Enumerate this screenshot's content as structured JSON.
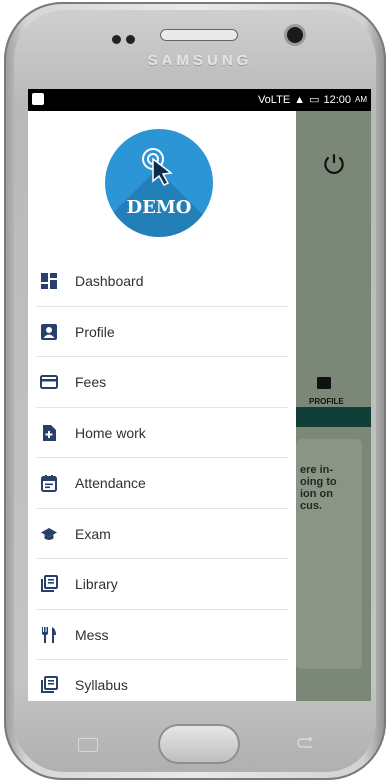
{
  "device": {
    "brand": "SAMSUNG"
  },
  "status_bar": {
    "time": "12:00",
    "ampm": "AM",
    "network": "VoLTE"
  },
  "logo": {
    "text": "DEMO"
  },
  "menu": {
    "items": [
      {
        "label": "Dashboard",
        "icon": "dashboard-icon"
      },
      {
        "label": "Profile",
        "icon": "profile-icon"
      },
      {
        "label": "Fees",
        "icon": "credit-card-icon"
      },
      {
        "label": "Home work",
        "icon": "homework-icon"
      },
      {
        "label": "Attendance",
        "icon": "calendar-icon"
      },
      {
        "label": "Exam",
        "icon": "graduation-cap-icon"
      },
      {
        "label": "Library",
        "icon": "library-icon"
      },
      {
        "label": "Mess",
        "icon": "restaurant-icon"
      },
      {
        "label": "Syllabus",
        "icon": "syllabus-icon"
      }
    ]
  },
  "background": {
    "profile_label": "PROFILE",
    "text_lines": [
      "ere in-",
      "oing to",
      "ion on",
      "cus."
    ]
  },
  "colors": {
    "accent": "#2b95d6",
    "icon": "#27406b",
    "backdrop": "#7c8877",
    "green_bar": "#123e38"
  }
}
